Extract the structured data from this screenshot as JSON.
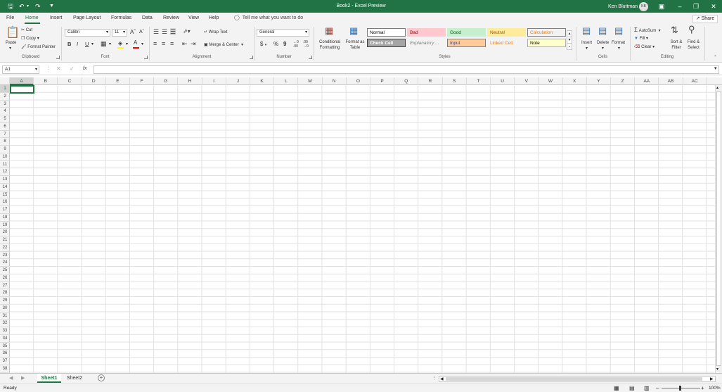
{
  "titlebar": {
    "title": "Book2  -  Excel Preview",
    "user": "Ken Bluttman",
    "avatar_initials": "KB",
    "colors": {
      "excel_green": "#217346"
    }
  },
  "menu": {
    "tabs": [
      "File",
      "Home",
      "Insert",
      "Page Layout",
      "Formulas",
      "Data",
      "Review",
      "View",
      "Help"
    ],
    "tell_me": "Tell me what you want to do",
    "share": "Share"
  },
  "ribbon": {
    "clipboard": {
      "paste": "Paste",
      "cut": "Cut",
      "copy": "Copy",
      "format_painter": "Format Painter",
      "label": "Clipboard"
    },
    "font": {
      "name": "Calibri",
      "size": "11",
      "bold": "B",
      "italic": "I",
      "underline": "U",
      "label": "Font"
    },
    "alignment": {
      "wrap_text": "Wrap Text",
      "merge_center": "Merge & Center",
      "label": "Alignment"
    },
    "number": {
      "format": "General",
      "currency": "$",
      "percent": "%",
      "comma": "9",
      "label": "Number"
    },
    "styles": {
      "conditional_formatting": "Conditional Formatting",
      "format_as_table": "Format as Table",
      "cells": [
        {
          "name": "Normal",
          "bg": "#ffffff",
          "fg": "#000000",
          "border": "#7a7a7a"
        },
        {
          "name": "Bad",
          "bg": "#ffc7ce",
          "fg": "#9c0006",
          "border": "#ffc7ce"
        },
        {
          "name": "Good",
          "bg": "#c6efce",
          "fg": "#006100",
          "border": "#c6efce"
        },
        {
          "name": "Neutral",
          "bg": "#ffeb9c",
          "fg": "#9c5700",
          "border": "#ffeb9c"
        },
        {
          "name": "Calculation",
          "bg": "#f2f2f2",
          "fg": "#fa7d00",
          "border": "#7f7f7f"
        },
        {
          "name": "Check Cell",
          "bg": "#a5a5a5",
          "fg": "#ffffff",
          "border": "#3f3f3f"
        },
        {
          "name": "Explanatory ...",
          "bg": "#f3f3f3",
          "fg": "#7f7f7f",
          "border": "#f3f3f3"
        },
        {
          "name": "Input",
          "bg": "#ffcc99",
          "fg": "#3f3f76",
          "border": "#7f7f7f"
        },
        {
          "name": "Linked Cell",
          "bg": "#f3f3f3",
          "fg": "#fa7d00",
          "border": "#f3f3f3"
        },
        {
          "name": "Note",
          "bg": "#ffffcc",
          "fg": "#000000",
          "border": "#b2b2b2"
        }
      ],
      "label": "Styles"
    },
    "cells": {
      "insert": "Insert",
      "delete": "Delete",
      "format": "Format",
      "label": "Cells"
    },
    "editing": {
      "autosum": "AutoSum",
      "fill": "Fill",
      "clear": "Clear",
      "sort_filter": "Sort & Filter",
      "find_select": "Find & Select",
      "label": "Editing"
    }
  },
  "formula_bar": {
    "name_box": "A1",
    "fx": "fx",
    "content": ""
  },
  "grid": {
    "columns": [
      "A",
      "B",
      "C",
      "D",
      "E",
      "F",
      "G",
      "H",
      "I",
      "J",
      "K",
      "L",
      "M",
      "N",
      "O",
      "P",
      "Q",
      "R",
      "S",
      "T",
      "U",
      "V",
      "W",
      "X",
      "Y",
      "Z",
      "AA",
      "AB",
      "AC"
    ],
    "rows": [
      "1",
      "2",
      "3",
      "4",
      "5",
      "6",
      "7",
      "8",
      "9",
      "10",
      "11",
      "12",
      "13",
      "14",
      "15",
      "16",
      "17",
      "18",
      "19",
      "20",
      "21",
      "22",
      "23",
      "24",
      "25",
      "26",
      "27",
      "28",
      "29",
      "30",
      "31",
      "32",
      "33",
      "34",
      "35",
      "36",
      "37",
      "38"
    ],
    "selected_cell": "A1"
  },
  "sheets": {
    "tabs": [
      "Sheet1",
      "Sheet2"
    ],
    "active": "Sheet1"
  },
  "status": {
    "ready": "Ready",
    "zoom": "100%"
  }
}
